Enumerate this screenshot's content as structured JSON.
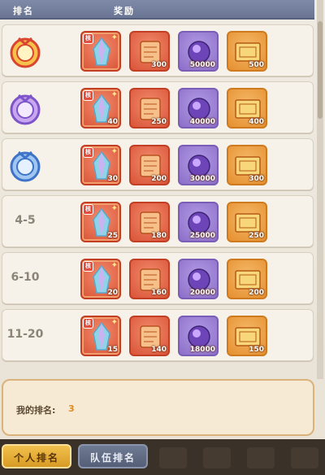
{
  "header": {
    "rank_label": "排名",
    "reward_label": "奖励"
  },
  "rows": [
    {
      "rank": "1",
      "badge": "gold-medal",
      "items": [
        {
          "type": "crystal",
          "qty": "",
          "core": "核"
        },
        {
          "type": "scroll",
          "qty": "300"
        },
        {
          "type": "gem",
          "qty": "50000"
        },
        {
          "type": "ticket",
          "qty": "500"
        }
      ]
    },
    {
      "rank": "2",
      "badge": "silver-medal",
      "items": [
        {
          "type": "crystal",
          "qty": "40",
          "core": "核"
        },
        {
          "type": "scroll",
          "qty": "250"
        },
        {
          "type": "gem",
          "qty": "40000"
        },
        {
          "type": "ticket",
          "qty": "400"
        }
      ]
    },
    {
      "rank": "3",
      "badge": "bronze-medal",
      "items": [
        {
          "type": "crystal",
          "qty": "30",
          "core": "核"
        },
        {
          "type": "scroll",
          "qty": "200"
        },
        {
          "type": "gem",
          "qty": "30000"
        },
        {
          "type": "ticket",
          "qty": "300"
        }
      ]
    },
    {
      "rank": "4-5",
      "badge": "",
      "items": [
        {
          "type": "crystal",
          "qty": "25",
          "core": "核"
        },
        {
          "type": "scroll",
          "qty": "180"
        },
        {
          "type": "gem",
          "qty": "25000"
        },
        {
          "type": "ticket",
          "qty": "250"
        }
      ]
    },
    {
      "rank": "6-10",
      "badge": "",
      "items": [
        {
          "type": "crystal",
          "qty": "20",
          "core": "核"
        },
        {
          "type": "scroll",
          "qty": "160"
        },
        {
          "type": "gem",
          "qty": "20000"
        },
        {
          "type": "ticket",
          "qty": "200"
        }
      ]
    },
    {
      "rank": "11-20",
      "badge": "",
      "items": [
        {
          "type": "crystal",
          "qty": "15",
          "core": "核"
        },
        {
          "type": "scroll",
          "qty": "140"
        },
        {
          "type": "gem",
          "qty": "18000"
        },
        {
          "type": "ticket",
          "qty": "150"
        }
      ]
    }
  ],
  "my_rank": {
    "label": "我的排名:",
    "value": "3"
  },
  "tabs": [
    {
      "label": "个人排名",
      "active": true
    },
    {
      "label": "队伍排名",
      "active": false
    }
  ],
  "colors": {
    "header": "#6f7a98",
    "accent": "#e08a1d",
    "active_tab": "#e4ac36"
  }
}
